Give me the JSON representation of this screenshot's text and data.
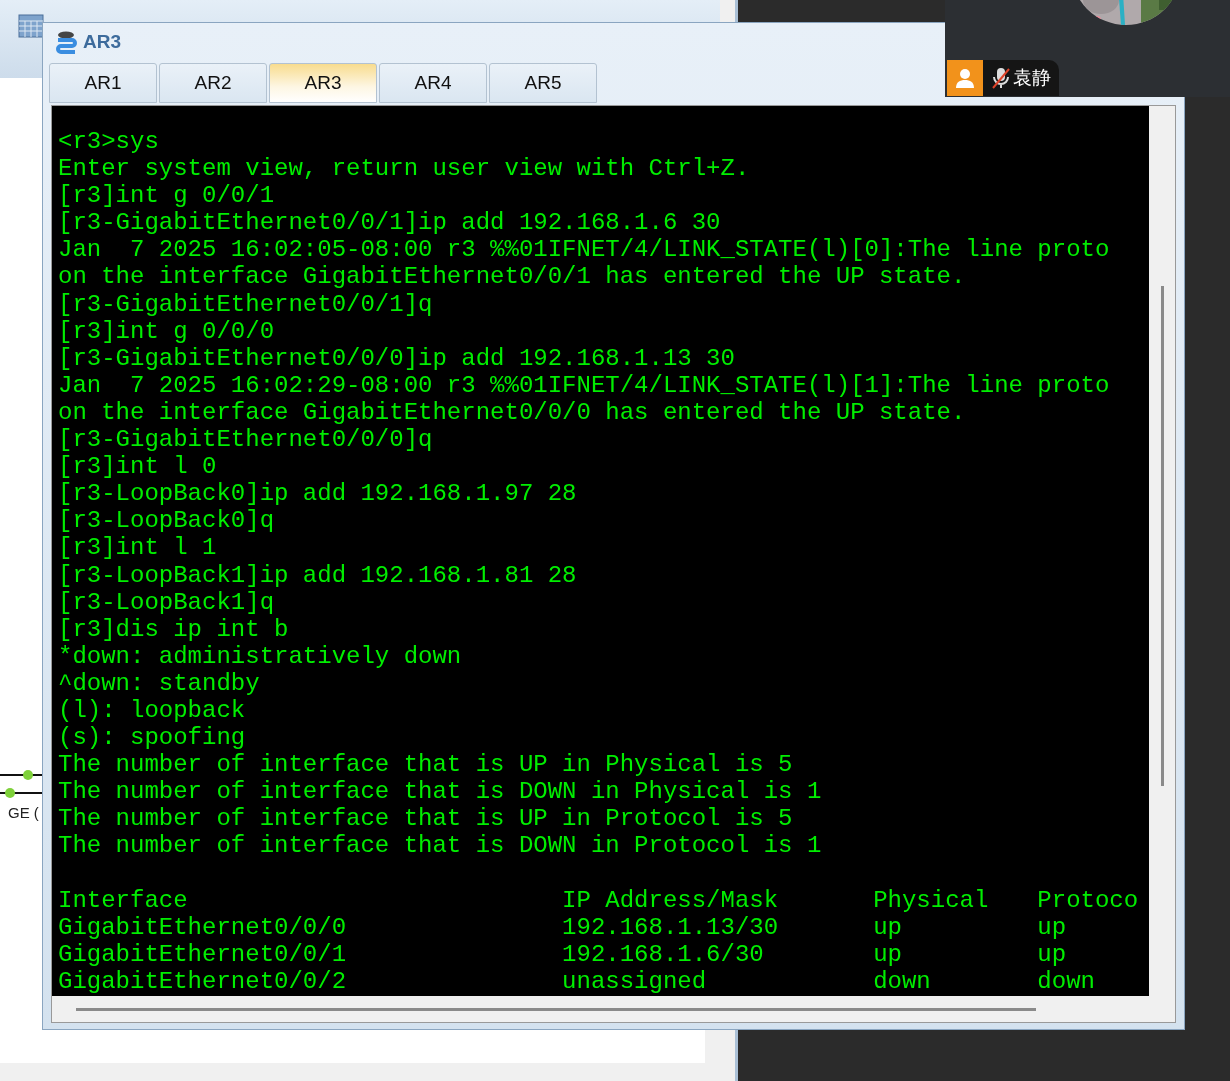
{
  "canvas": {
    "port_label": "GE ("
  },
  "call_overlay": {
    "name": "袁静",
    "muted": true
  },
  "window": {
    "title": "AR3"
  },
  "tabs": [
    {
      "label": "AR1",
      "selected": false
    },
    {
      "label": "AR2",
      "selected": false
    },
    {
      "label": "AR3",
      "selected": true
    },
    {
      "label": "AR4",
      "selected": false
    },
    {
      "label": "AR5",
      "selected": false
    }
  ],
  "terminal": {
    "lines": [
      "<r3>sys",
      "Enter system view, return user view with Ctrl+Z.",
      "[r3]int g 0/0/1",
      "[r3-GigabitEthernet0/0/1]ip add 192.168.1.6 30",
      "Jan  7 2025 16:02:05-08:00 r3 %%01IFNET/4/LINK_STATE(l)[0]:The line proto",
      "on the interface GigabitEthernet0/0/1 has entered the UP state.",
      "[r3-GigabitEthernet0/0/1]q",
      "[r3]int g 0/0/0",
      "[r3-GigabitEthernet0/0/0]ip add 192.168.1.13 30",
      "Jan  7 2025 16:02:29-08:00 r3 %%01IFNET/4/LINK_STATE(l)[1]:The line proto",
      "on the interface GigabitEthernet0/0/0 has entered the UP state.",
      "[r3-GigabitEthernet0/0/0]q",
      "[r3]int l 0",
      "[r3-LoopBack0]ip add 192.168.1.97 28",
      "[r3-LoopBack0]q",
      "[r3]int l 1",
      "[r3-LoopBack1]ip add 192.168.1.81 28",
      "[r3-LoopBack1]q",
      "[r3]dis ip int b",
      "*down: administratively down",
      "^down: standby",
      "(l): loopback",
      "(s): spoofing",
      "The number of interface that is UP in Physical is 5",
      "The number of interface that is DOWN in Physical is 1",
      "The number of interface that is UP in Protocol is 5",
      "The number of interface that is DOWN in Protocol is 1"
    ],
    "table": {
      "columns": [
        "Interface",
        "IP Address/Mask",
        "Physical",
        "Protoco"
      ],
      "rows": [
        [
          "GigabitEthernet0/0/0",
          "192.168.1.13/30",
          "up",
          "up"
        ],
        [
          "GigabitEthernet0/0/1",
          "192.168.1.6/30",
          "up",
          "up"
        ],
        [
          "GigabitEthernet0/0/2",
          "unassigned",
          "down",
          "down"
        ]
      ]
    }
  }
}
